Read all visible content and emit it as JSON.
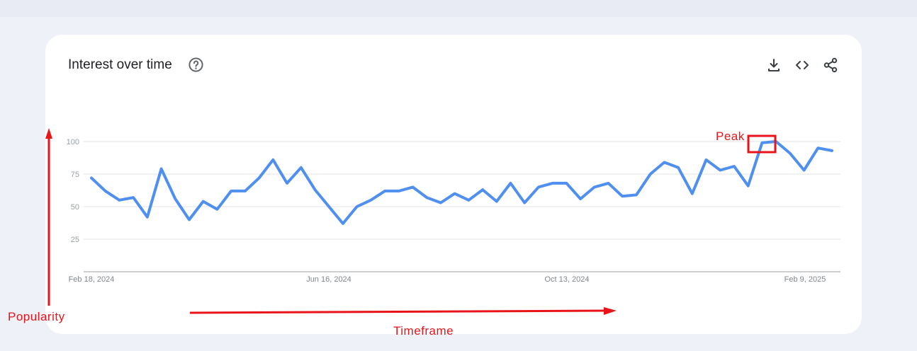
{
  "card": {
    "title": "Interest over time",
    "icons": {
      "help": "help-circle-icon",
      "download": "download-icon",
      "embed": "code-icon",
      "share": "share-icon"
    }
  },
  "annotations": {
    "peak": "Peak",
    "y_axis": "Popularity",
    "x_axis": "Timeframe"
  },
  "colors": {
    "line": "#4f8fef",
    "annotation": "#e8141a",
    "grid": "#e3e3e3",
    "tick_text": "#80868b"
  },
  "chart_data": {
    "type": "line",
    "ylim": [
      0,
      100
    ],
    "yticks": [
      25,
      50,
      75,
      100
    ],
    "grid": true,
    "xlabels": [
      "Feb 18, 2024",
      "Jun 16, 2024",
      "Oct 13, 2024",
      "Feb 9, 2025"
    ],
    "x": [
      "2024-02-18",
      "2024-02-25",
      "2024-03-03",
      "2024-03-10",
      "2024-03-17",
      "2024-03-24",
      "2024-03-31",
      "2024-04-07",
      "2024-04-14",
      "2024-04-21",
      "2024-04-28",
      "2024-05-05",
      "2024-05-12",
      "2024-05-19",
      "2024-05-26",
      "2024-06-02",
      "2024-06-09",
      "2024-06-16",
      "2024-06-23",
      "2024-06-30",
      "2024-07-07",
      "2024-07-14",
      "2024-07-21",
      "2024-07-28",
      "2024-08-04",
      "2024-08-11",
      "2024-08-18",
      "2024-08-25",
      "2024-09-01",
      "2024-09-08",
      "2024-09-15",
      "2024-09-22",
      "2024-09-29",
      "2024-10-06",
      "2024-10-13",
      "2024-10-20",
      "2024-10-27",
      "2024-11-03",
      "2024-11-10",
      "2024-11-17",
      "2024-11-24",
      "2024-12-01",
      "2024-12-08",
      "2024-12-15",
      "2024-12-22",
      "2024-12-29",
      "2025-01-05",
      "2025-01-12",
      "2025-01-19",
      "2025-01-26",
      "2025-02-02",
      "2025-02-09",
      "2025-02-16",
      "2025-02-23"
    ],
    "series": [
      {
        "values": [
          72,
          62,
          55,
          57,
          42,
          79,
          56,
          40,
          54,
          48,
          62,
          62,
          72,
          86,
          68,
          80,
          63,
          50,
          37,
          50,
          55,
          62,
          62,
          65,
          57,
          53,
          60,
          55,
          63,
          54,
          68,
          53,
          65,
          68,
          68,
          56,
          65,
          68,
          58,
          59,
          75,
          84,
          80,
          60,
          86,
          78,
          81,
          66,
          99,
          100,
          91,
          78,
          95,
          93
        ]
      }
    ]
  }
}
